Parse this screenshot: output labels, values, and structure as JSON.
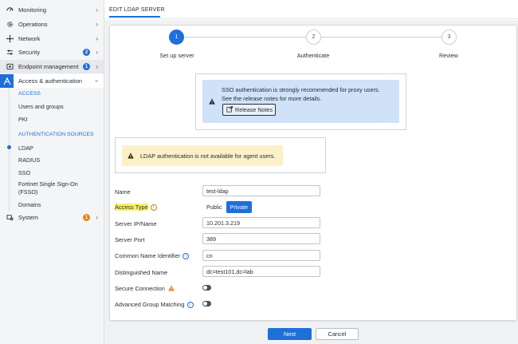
{
  "sidebar": {
    "items": [
      {
        "label": "Monitoring"
      },
      {
        "label": "Operations"
      },
      {
        "label": "Network"
      },
      {
        "label": "Security",
        "badge": "2"
      },
      {
        "label": "Endpoint management",
        "badge": "1"
      },
      {
        "label": "Access & authentication"
      },
      {
        "label": "System",
        "badge": "1"
      }
    ],
    "access_header": "ACCESS",
    "access_items": [
      "Users and groups",
      "PKI"
    ],
    "auth_header": "AUTHENTICATION SOURCES",
    "auth_items": [
      "LDAP",
      "RADIUS",
      "SSO",
      "Fortinet Single Sign-On",
      "(FSSO)",
      "Domains"
    ]
  },
  "header": {
    "title": "EDIT LDAP SERVER"
  },
  "stepper": {
    "steps": [
      {
        "num": "1",
        "label": "Set up server"
      },
      {
        "num": "2",
        "label": "Authenticate"
      },
      {
        "num": "3",
        "label": "Review"
      }
    ]
  },
  "info_banner": {
    "line1": "SSO authentication is strongly recommended for proxy users.",
    "line2": "See the release notes for more details.",
    "button": "Release Notes"
  },
  "warning_banner": {
    "text": "LDAP authentication is not available for agent users."
  },
  "form": {
    "name_label": "Name",
    "name_value": "test-ldap",
    "access_type_label": "Access Type",
    "access_public": "Public",
    "access_private": "Private",
    "server_ip_label": "Server IP/Name",
    "server_ip_value": "10.201.3.219",
    "server_port_label": "Server Port",
    "server_port_value": "389",
    "cn_label": "Common Name Identifier",
    "cn_value": "cn",
    "dn_label": "Distinguished Name",
    "dn_value": "dc=test101,dc=lab",
    "secure_label": "Secure Connection",
    "advanced_label": "Advanced Group Matching"
  },
  "footer": {
    "next": "Next",
    "cancel": "Cancel"
  },
  "colors": {
    "accent": "#1f6fd8",
    "badge_orange": "#e8811a",
    "warning_bg": "#fbf0c8",
    "info_bg": "#cfe2f7"
  }
}
